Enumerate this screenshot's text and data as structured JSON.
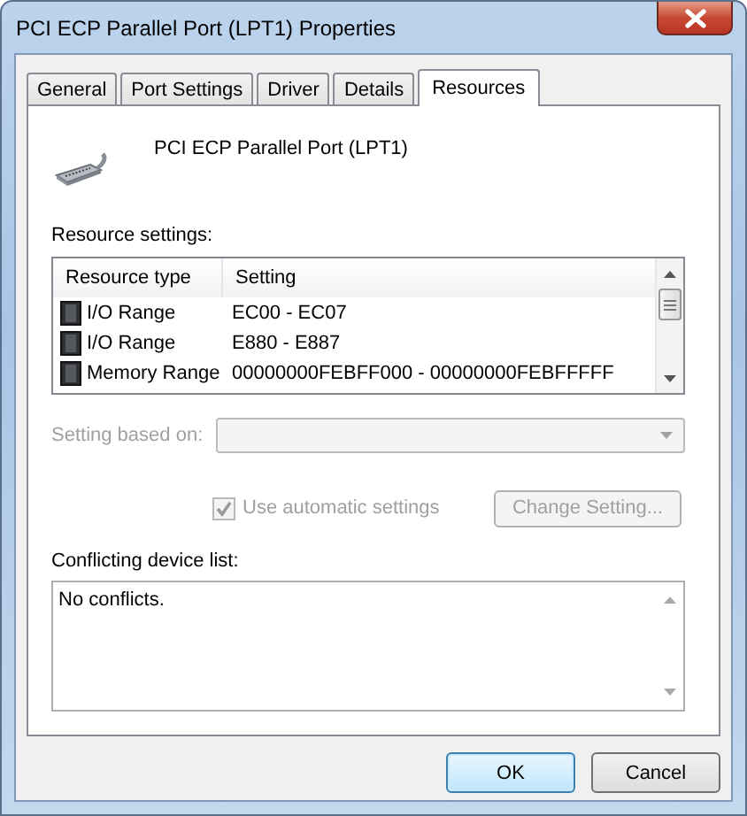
{
  "window": {
    "title": "PCI ECP Parallel Port (LPT1) Properties"
  },
  "tabs": [
    {
      "label": "General",
      "selected": false
    },
    {
      "label": "Port Settings",
      "selected": false
    },
    {
      "label": "Driver",
      "selected": false
    },
    {
      "label": "Details",
      "selected": false
    },
    {
      "label": "Resources",
      "selected": true
    }
  ],
  "device": {
    "name": "PCI ECP Parallel Port (LPT1)"
  },
  "resource_settings": {
    "label": "Resource settings:",
    "columns": [
      "Resource type",
      "Setting"
    ],
    "rows": [
      {
        "type": "I/O Range",
        "setting": "EC00 - EC07"
      },
      {
        "type": "I/O Range",
        "setting": "E880 - E887"
      },
      {
        "type": "Memory Range",
        "setting": "00000000FEBFF000 - 00000000FEBFFFFF"
      }
    ]
  },
  "setting_based_on": {
    "label": "Setting based on:",
    "disabled": true
  },
  "use_automatic_settings": {
    "label": "Use automatic settings",
    "checked": true,
    "disabled": true
  },
  "change_setting_button": {
    "label": "Change Setting...",
    "disabled": true
  },
  "conflicts": {
    "label": "Conflicting device list:",
    "text": "No conflicts."
  },
  "buttons": [
    {
      "label": "OK",
      "default": true
    },
    {
      "label": "Cancel",
      "default": false
    }
  ]
}
